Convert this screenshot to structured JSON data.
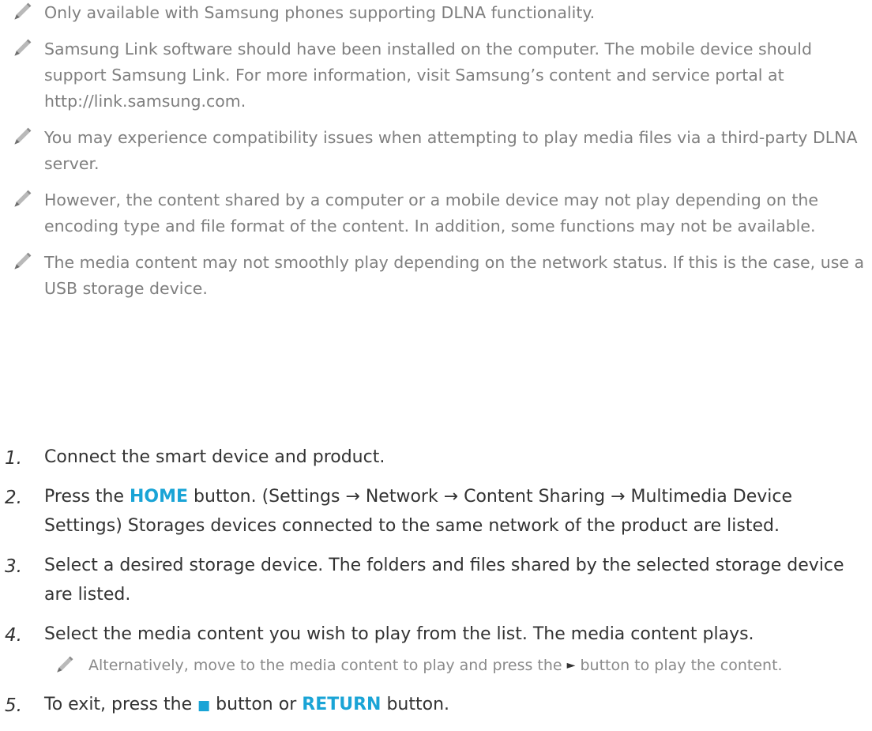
{
  "notes": [
    "Only available with Samsung phones supporting DLNA functionality.",
    "Samsung Link software should have been installed on the computer. The mobile device should support Samsung Link. For more information, visit Samsung’s content and service portal at http://link.samsung.com.",
    "You may experience compatibility issues when attempting to play media files via a third-party DLNA server.",
    "However, the content shared by a computer or a mobile device may not play depending on the encoding type and file format of the content. In addition, some functions may not be available.",
    "The media content may not smoothly play depending on the network status. If this is the case, use a USB storage device."
  ],
  "steps": {
    "s1": {
      "num": "1.",
      "text": "Connect the smart device and product."
    },
    "s2": {
      "num": "2.",
      "pre": "Press the ",
      "key": "HOME",
      "post": " button. (Settings → Network → Content Sharing → Multimedia Device Settings) Storages devices connected to the same network of the product are listed."
    },
    "s3": {
      "num": "3.",
      "text": "Select a desired storage device. The folders and files shared by the selected storage device are listed."
    },
    "s4": {
      "num": "4.",
      "text": "Select the media content you wish to play from the list. The media content plays.",
      "subnote_pre": "Alternatively, move to the media content to play and press the ",
      "subnote_glyph": "►",
      "subnote_post": " button to play the content."
    },
    "s5": {
      "num": "5.",
      "pre": "To exit, press the ",
      "glyph": "■",
      "mid": " button or ",
      "key": "RETURN",
      "post": " button."
    }
  },
  "colors": {
    "accent": "#1aa4d6",
    "note_text": "#7f7f7f",
    "body_text": "#333333"
  },
  "icons": {
    "note": "pencil-icon"
  }
}
